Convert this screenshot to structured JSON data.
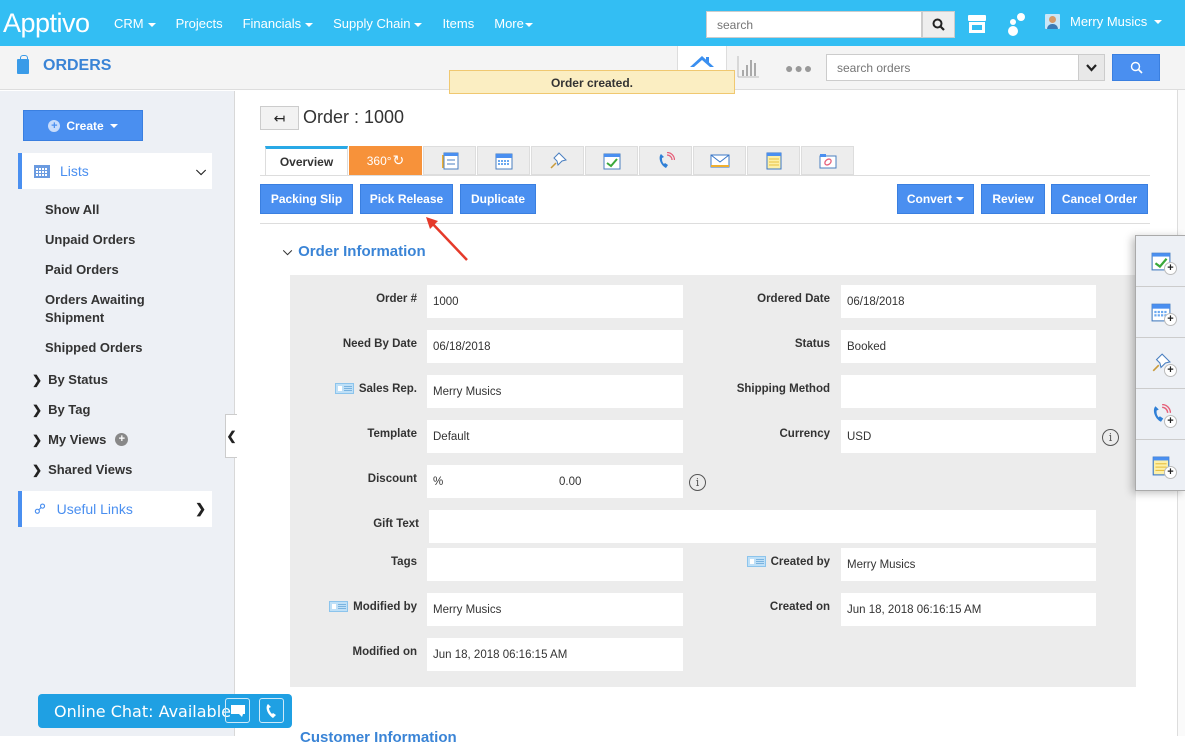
{
  "topbar": {
    "logo": "Apptivo",
    "nav": [
      {
        "label": "CRM",
        "dropdown": true
      },
      {
        "label": "Projects",
        "dropdown": false
      },
      {
        "label": "Financials",
        "dropdown": true
      },
      {
        "label": "Supply Chain",
        "dropdown": true
      },
      {
        "label": "Items",
        "dropdown": false
      },
      {
        "label": "More",
        "dropdown": true
      }
    ],
    "search_placeholder": "search",
    "user_name": "Merry Musics",
    "icons": [
      "search-icon",
      "store-icon",
      "people-icon",
      "avatar"
    ]
  },
  "subbar": {
    "app_title": "ORDERS",
    "search_placeholder": "search orders",
    "icons": [
      "home-icon",
      "chart-icon",
      "more-dots-icon",
      "chevron-down-icon",
      "search-icon"
    ]
  },
  "toast": "Order created.",
  "sidebar": {
    "create_label": "Create",
    "lists_label": "Lists",
    "list_items": [
      "Show All",
      "Unpaid Orders",
      "Paid Orders",
      "Orders Awaiting Shipment",
      "Shipped Orders"
    ],
    "groups": [
      "By Status",
      "By Tag",
      "My Views",
      "Shared Views"
    ],
    "useful_links_label": "Useful Links"
  },
  "page": {
    "back_icon": "back-arrow-icon",
    "title": "Order : 1000",
    "tabs": [
      {
        "label": "Overview",
        "active": true
      },
      {
        "label": "360°",
        "icon": "refresh-360-icon"
      },
      {
        "icon": "form-list-icon"
      },
      {
        "icon": "calendar-icon"
      },
      {
        "icon": "pushpin-icon"
      },
      {
        "icon": "task-check-icon"
      },
      {
        "icon": "phone-call-icon"
      },
      {
        "icon": "email-icon"
      },
      {
        "icon": "note-icon"
      },
      {
        "icon": "attachment-icon"
      }
    ],
    "actions_left": [
      "Packing Slip",
      "Pick Release",
      "Duplicate"
    ],
    "actions_right": [
      "Convert",
      "Review",
      "Cancel Order"
    ]
  },
  "order_information": {
    "section_title": "Order Information",
    "fields": {
      "order_no": {
        "label": "Order #",
        "value": "1000"
      },
      "ordered_date": {
        "label": "Ordered Date",
        "value": "06/18/2018"
      },
      "need_by_date": {
        "label": "Need By Date",
        "value": "06/18/2018"
      },
      "status": {
        "label": "Status",
        "value": "Booked"
      },
      "sales_rep": {
        "label": "Sales Rep.",
        "value": "Merry Musics"
      },
      "shipping_method": {
        "label": "Shipping Method",
        "value": ""
      },
      "template": {
        "label": "Template",
        "value": "Default"
      },
      "currency": {
        "label": "Currency",
        "value": "USD"
      },
      "discount": {
        "label": "Discount",
        "unit": "%",
        "value": "0.00"
      },
      "gift_text": {
        "label": "Gift Text",
        "value": ""
      },
      "tags": {
        "label": "Tags",
        "value": ""
      },
      "created_by": {
        "label": "Created by",
        "value": "Merry Musics"
      },
      "modified_by": {
        "label": "Modified by",
        "value": "Merry Musics"
      },
      "created_on": {
        "label": "Created on",
        "value": "Jun 18, 2018 06:16:15 AM"
      },
      "modified_on": {
        "label": "Modified on",
        "value": "Jun 18, 2018 06:16:15 AM"
      }
    }
  },
  "next_section_title": "Customer Information",
  "quick_add_panel": [
    "add-task-icon",
    "add-event-icon",
    "add-follow-up-icon",
    "add-call-icon",
    "add-note-icon"
  ],
  "chat": {
    "label": "Online Chat: Available"
  },
  "colors": {
    "topbar": "#33bef3",
    "primary_button": "#4a8ff0",
    "accent_360": "#f7923a",
    "link_blue": "#3a84d6",
    "toast_bg": "#fbeec2"
  }
}
